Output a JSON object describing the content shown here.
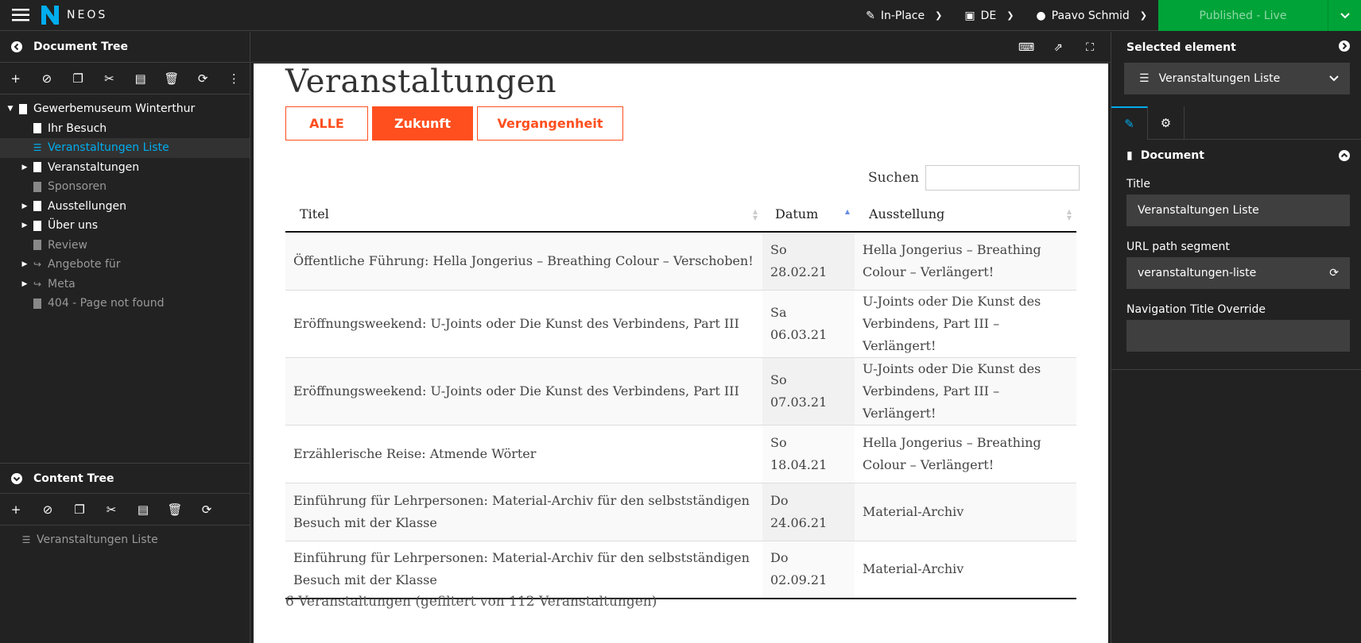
{
  "topbar": {
    "logo_text": "NEOS",
    "mode": "In-Place",
    "language": "DE",
    "user": "Paavo Schmid",
    "publish": "Published - Live"
  },
  "document_tree": {
    "title": "Document Tree",
    "nodes": [
      {
        "label": "Gewerbemuseum Winterthur"
      },
      {
        "label": "Ihr Besuch"
      },
      {
        "label": "Veranstaltungen Liste"
      },
      {
        "label": "Veranstaltungen"
      },
      {
        "label": "Sponsoren"
      },
      {
        "label": "Ausstellungen"
      },
      {
        "label": "Über uns"
      },
      {
        "label": "Review"
      },
      {
        "label": "Angebote für"
      },
      {
        "label": "Meta"
      },
      {
        "label": "404 - Page not found"
      }
    ]
  },
  "content_tree": {
    "title": "Content Tree",
    "nodes": [
      {
        "label": "Veranstaltungen Liste"
      }
    ]
  },
  "page": {
    "title": "Veranstaltungen",
    "filters": [
      "ALLE",
      "Zukunft",
      "Vergangenheit"
    ],
    "search_label": "Suchen",
    "columns": [
      "Titel",
      "Datum",
      "Ausstellung"
    ],
    "rows": [
      {
        "titel": "Öffentliche Führung: Hella Jongerius – Breathing Colour – Verschoben!",
        "datum": "So 28.02.21",
        "ausstellung": "Hella Jongerius – Breathing Colour – Verlängert!"
      },
      {
        "titel": "Eröffnungsweekend: U-Joints oder Die Kunst des Verbindens, Part III",
        "datum": "Sa 06.03.21",
        "ausstellung": "U-Joints oder Die Kunst des Verbindens, Part III – Verlängert!"
      },
      {
        "titel": "Eröffnungsweekend: U-Joints oder Die Kunst des Verbindens, Part III",
        "datum": "So 07.03.21",
        "ausstellung": "U-Joints oder Die Kunst des Verbindens, Part III – Verlängert!"
      },
      {
        "titel": "Erzählerische Reise: Atmende Wörter",
        "datum": "So 18.04.21",
        "ausstellung": "Hella Jongerius – Breathing Colour – Verlängert!"
      },
      {
        "titel": "Einführung für Lehrpersonen: Material-Archiv für den selbstständigen Besuch mit der Klasse",
        "datum": "Do 24.06.21",
        "ausstellung": "Material-Archiv"
      },
      {
        "titel": "Einführung für Lehrpersonen: Material-Archiv für den selbstständigen Besuch mit der Klasse",
        "datum": "Do 02.09.21",
        "ausstellung": "Material-Archiv"
      }
    ],
    "summary": "6 Veranstaltungen (gefiltert von 112 Veranstaltungen)"
  },
  "inspector": {
    "title": "Selected element",
    "selected": "Veranstaltungen Liste",
    "section": "Document",
    "fields": [
      {
        "label": "Title",
        "value": "Veranstaltungen Liste"
      },
      {
        "label": "URL path segment",
        "value": "veranstaltungen-liste"
      },
      {
        "label": "Navigation Title Override",
        "value": ""
      }
    ]
  },
  "colors": {
    "accent": "#00adee",
    "brand_orange": "#ff4f1f",
    "publish_green": "#00a338"
  }
}
